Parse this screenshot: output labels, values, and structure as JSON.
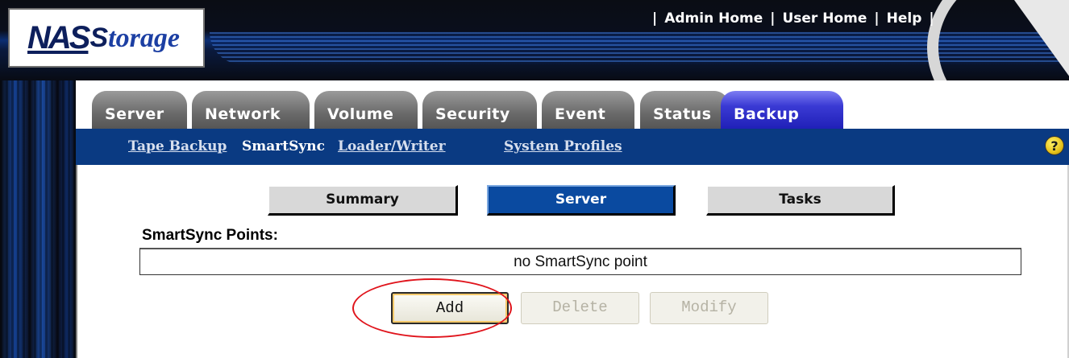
{
  "logo": {
    "part1": "NAS",
    "part2": "torage",
    "s": "S"
  },
  "top_links": [
    "Admin Home",
    "User Home",
    "Help"
  ],
  "tabs": [
    {
      "label": "Server",
      "active": false
    },
    {
      "label": "Network",
      "active": false
    },
    {
      "label": "Volume",
      "active": false
    },
    {
      "label": "Security",
      "active": false
    },
    {
      "label": "Event",
      "active": false
    },
    {
      "label": "Status",
      "active": false
    },
    {
      "label": "Backup",
      "active": true
    }
  ],
  "subnav": [
    {
      "label": "Tape Backup",
      "current": false
    },
    {
      "label": "SmartSync",
      "current": true
    },
    {
      "label": "Loader/Writer",
      "current": false
    },
    {
      "label": "System Profiles",
      "current": false
    }
  ],
  "help_icon": "?",
  "segments": [
    {
      "label": "Summary",
      "active": false
    },
    {
      "label": "Server",
      "active": true
    },
    {
      "label": "Tasks",
      "active": false
    }
  ],
  "points": {
    "label": "SmartSync Points:",
    "empty_text": "no SmartSync point"
  },
  "actions": [
    {
      "label": "Add",
      "enabled": true
    },
    {
      "label": "Delete",
      "enabled": false
    },
    {
      "label": "Modify",
      "enabled": false
    }
  ],
  "colors": {
    "active_tab": "#2a2acc",
    "subnav_bar": "#0a3a82",
    "active_segment": "#0a4aa0",
    "annotation": "#e0141c"
  }
}
